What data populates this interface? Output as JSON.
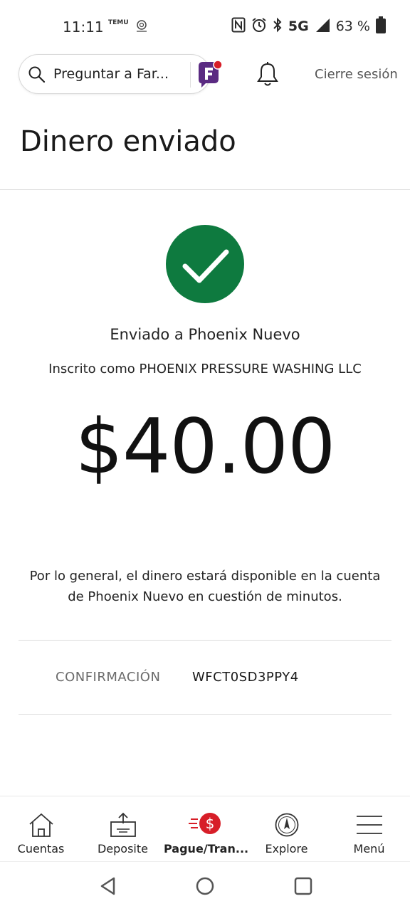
{
  "status_bar": {
    "time": "11:11",
    "mini_icon_1": "TEMU",
    "mini_icon_2": "cubicfarms",
    "network": "5G",
    "battery": "63 %",
    "icons": [
      "nfc-icon",
      "alarm-icon",
      "bluetooth-icon",
      "signal-icon",
      "battery-icon"
    ]
  },
  "header": {
    "search_placeholder": "Preguntar a Far...",
    "signout_label": "Cierre sesión",
    "page_title": "Dinero enviado"
  },
  "confirmation": {
    "sent_to": "Enviado a Phoenix Nuevo",
    "enrolled_as": "Inscrito como PHOENIX PRESSURE WASHING LLC",
    "amount": "$40.00",
    "availability": "Por lo general, el dinero estará disponible en la cuenta de Phoenix Nuevo en cuestión de minutos.",
    "confirmation_label": "CONFIRMACIÓN",
    "confirmation_code": "WFCT0SD3PPY4"
  },
  "bottom_nav": [
    {
      "label": "Cuentas",
      "icon": "home-icon",
      "active": false
    },
    {
      "label": "Deposite",
      "icon": "deposit-icon",
      "active": false
    },
    {
      "label": "Pague/Tran...",
      "icon": "pay-transfer-icon",
      "active": true
    },
    {
      "label": "Explore",
      "icon": "compass-icon",
      "active": false
    },
    {
      "label": "Menú",
      "icon": "menu-icon",
      "active": false
    }
  ],
  "colors": {
    "success_green": "#0e7a3f",
    "accent_red": "#d71e28",
    "fargo_purple": "#5a2a82"
  }
}
